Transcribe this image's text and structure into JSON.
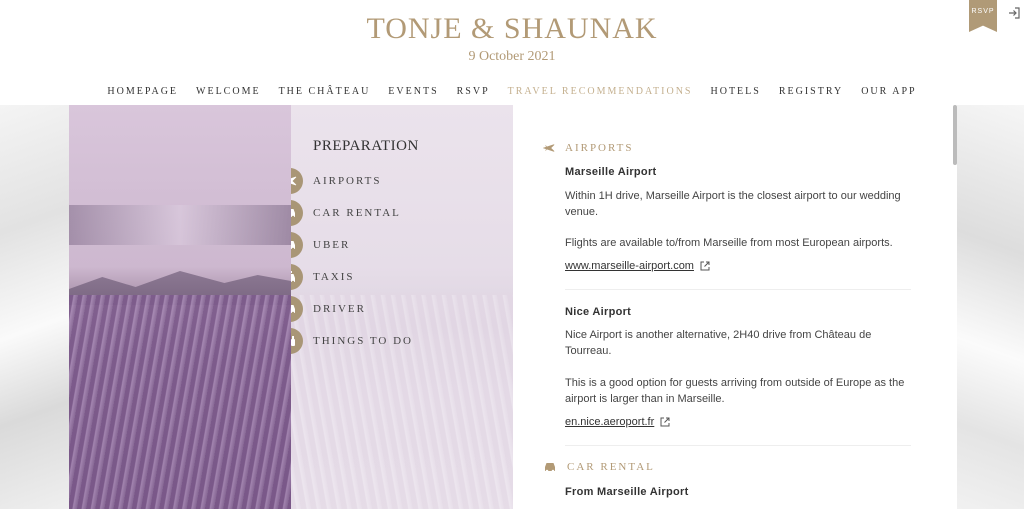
{
  "header": {
    "title": "TONJE & SHAUNAK",
    "date": "9 October 2021",
    "rsvp_badge": "RSVP"
  },
  "nav": [
    {
      "label": "HOMEPAGE"
    },
    {
      "label": "WELCOME"
    },
    {
      "label": "THE CHÂTEAU"
    },
    {
      "label": "EVENTS"
    },
    {
      "label": "RSVP"
    },
    {
      "label": "TRAVEL RECOMMENDATIONS",
      "active": true
    },
    {
      "label": "HOTELS"
    },
    {
      "label": "REGISTRY"
    },
    {
      "label": "OUR APP"
    }
  ],
  "preparation": {
    "heading": "PREPARATION",
    "items": [
      {
        "label": "AIRPORTS",
        "icon": "plane-icon"
      },
      {
        "label": "CAR RENTAL",
        "icon": "car-icon"
      },
      {
        "label": "UBER",
        "icon": "car-icon"
      },
      {
        "label": "TAXIS",
        "icon": "taxi-icon"
      },
      {
        "label": "DRIVER",
        "icon": "car-icon"
      },
      {
        "label": "THINGS TO DO",
        "icon": "binoculars-icon"
      }
    ]
  },
  "content": {
    "airports": {
      "heading": "AIRPORTS",
      "marseille": {
        "title": "Marseille Airport",
        "p1": "Within 1H drive, Marseille Airport is the closest airport to our wedding venue.",
        "p2": "Flights are available to/from Marseille from most European airports.",
        "link": "www.marseille-airport.com"
      },
      "nice": {
        "title": "Nice Airport",
        "p1": "Nice Airport is another alternative, 2H40 drive from Château de Tourreau.",
        "p2": "This is a good option for guests arriving from outside of Europe as the airport is larger than in Marseille.",
        "link": "en.nice.aeroport.fr"
      }
    },
    "car_rental": {
      "heading": "CAR RENTAL",
      "sub": "From Marseille Airport"
    }
  },
  "colors": {
    "gold": "#b29a76",
    "icon_circle": "#a99676",
    "active_nav": "#c4b08f"
  }
}
